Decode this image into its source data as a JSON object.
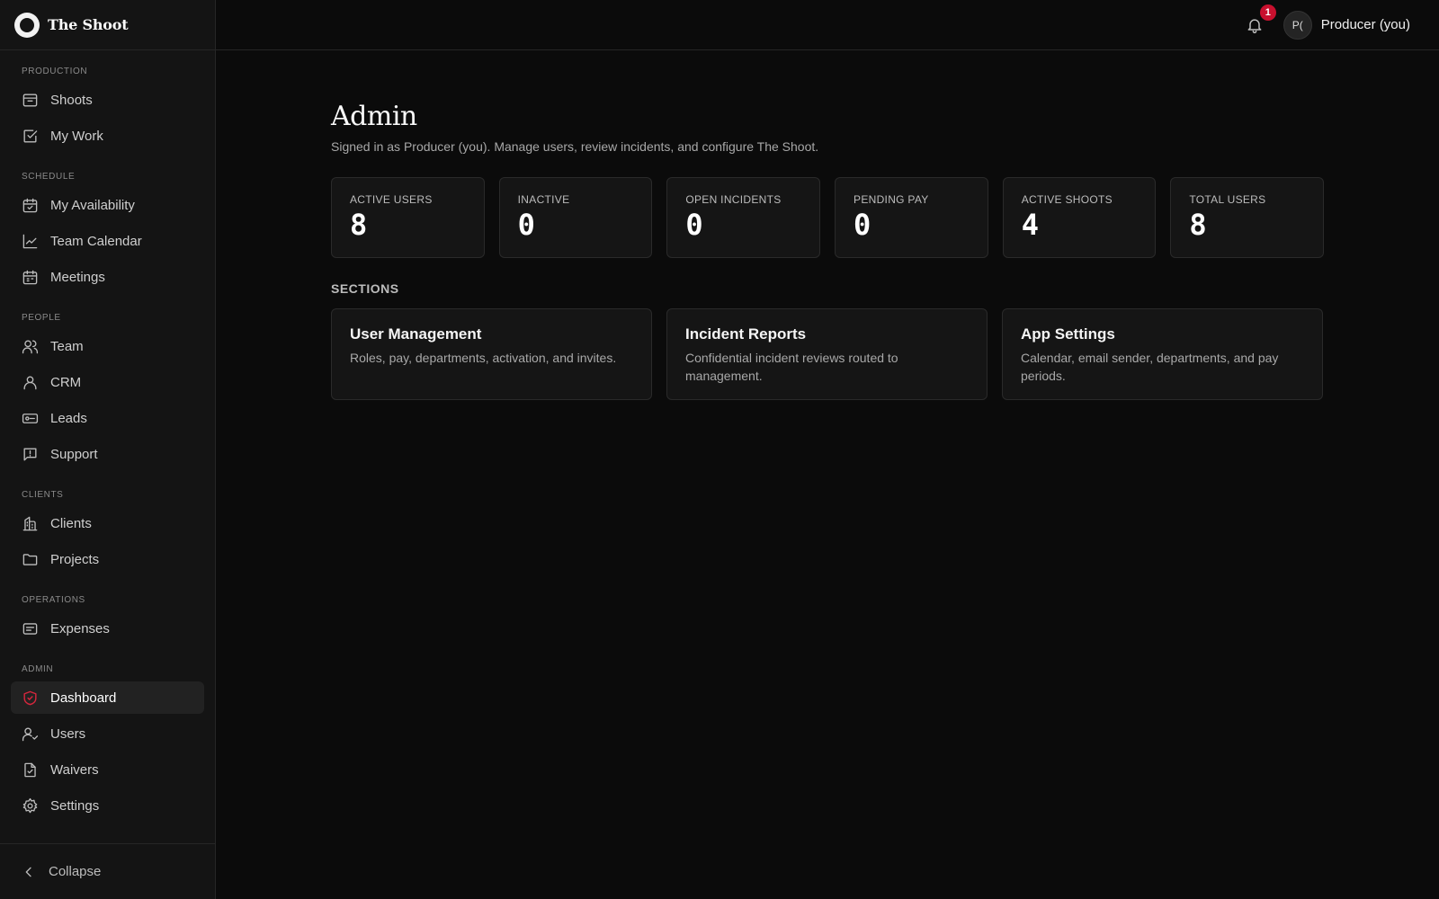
{
  "app": {
    "name": "The Shoot"
  },
  "sidebar": {
    "sections": [
      {
        "title": "PRODUCTION",
        "items": [
          {
            "label": "Shoots",
            "icon": "archive-icon"
          },
          {
            "label": "My Work",
            "icon": "checkbox-icon"
          }
        ]
      },
      {
        "title": "SCHEDULE",
        "items": [
          {
            "label": "My Availability",
            "icon": "calendar-check-icon"
          },
          {
            "label": "Team Calendar",
            "icon": "chart-line-icon"
          },
          {
            "label": "Meetings",
            "icon": "calendar-icon"
          }
        ]
      },
      {
        "title": "PEOPLE",
        "items": [
          {
            "label": "Team",
            "icon": "users-icon"
          },
          {
            "label": "CRM",
            "icon": "user-icon"
          },
          {
            "label": "Leads",
            "icon": "ticket-icon"
          },
          {
            "label": "Support",
            "icon": "message-alert-icon"
          }
        ]
      },
      {
        "title": "CLIENTS",
        "items": [
          {
            "label": "Clients",
            "icon": "building-icon"
          },
          {
            "label": "Projects",
            "icon": "folder-icon"
          }
        ]
      },
      {
        "title": "OPERATIONS",
        "items": [
          {
            "label": "Expenses",
            "icon": "receipt-icon"
          }
        ]
      },
      {
        "title": "ADMIN",
        "items": [
          {
            "label": "Dashboard",
            "icon": "shield-check-icon",
            "active": true
          },
          {
            "label": "Users",
            "icon": "user-check-icon"
          },
          {
            "label": "Waivers",
            "icon": "file-check-icon"
          },
          {
            "label": "Settings",
            "icon": "gear-icon"
          }
        ]
      }
    ],
    "collapse_label": "Collapse"
  },
  "topbar": {
    "notification_count": "1",
    "avatar_initials": "P(",
    "user_name": "Producer (you)"
  },
  "main": {
    "title": "Admin",
    "subtitle": "Signed in as Producer (you). Manage users, review incidents, and configure The Shoot.",
    "stats": [
      {
        "label": "ACTIVE USERS",
        "value": "8"
      },
      {
        "label": "INACTIVE",
        "value": "0"
      },
      {
        "label": "OPEN INCIDENTS",
        "value": "0"
      },
      {
        "label": "PENDING PAY",
        "value": "0"
      },
      {
        "label": "ACTIVE SHOOTS",
        "value": "4"
      },
      {
        "label": "TOTAL USERS",
        "value": "8"
      }
    ],
    "sections_title": "SECTIONS",
    "cards": [
      {
        "title": "User Management",
        "description": "Roles, pay, departments, activation, and invites."
      },
      {
        "title": "Incident Reports",
        "description": "Confidential incident reviews routed to management."
      },
      {
        "title": "App Settings",
        "description": "Calendar, email sender, departments, and pay periods."
      }
    ]
  },
  "colors": {
    "accent": "#c8102e",
    "background": "#0b0b0b",
    "sidebar": "#141414"
  }
}
